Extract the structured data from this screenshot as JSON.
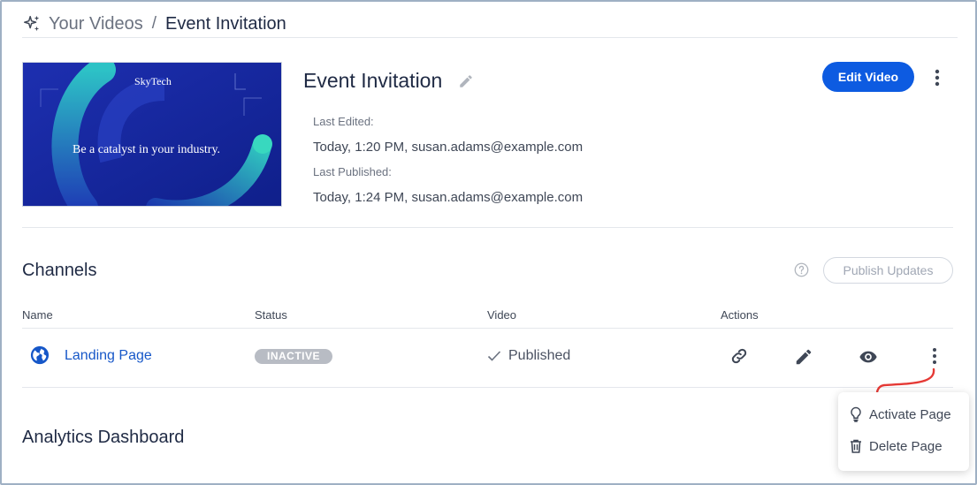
{
  "breadcrumb": {
    "root": "Your Videos",
    "separator": "/",
    "current": "Event Invitation"
  },
  "video": {
    "title": "Event Invitation",
    "thumbnail_brand": "SkyTech",
    "thumbnail_tagline": "Be a catalyst in your industry.",
    "last_edited_label": "Last Edited:",
    "last_edited_value": "Today, 1:20 PM, susan.adams@example.com",
    "last_published_label": "Last Published:",
    "last_published_value": "Today, 1:24 PM, susan.adams@example.com",
    "edit_button": "Edit Video"
  },
  "channels": {
    "title": "Channels",
    "publish_button": "Publish Updates",
    "columns": [
      "Name",
      "Status",
      "Video",
      "Actions"
    ],
    "rows": [
      {
        "name": "Landing Page",
        "status": "INACTIVE",
        "video": "Published",
        "actions": [
          "link-icon",
          "pencil-icon",
          "eye-icon",
          "more-vertical-icon"
        ]
      }
    ]
  },
  "row_menu": {
    "items": [
      {
        "label": "Activate Page",
        "icon": "lightbulb-icon"
      },
      {
        "label": "Delete Page",
        "icon": "trash-icon"
      }
    ]
  },
  "analytics": {
    "title": "Analytics Dashboard"
  },
  "colors": {
    "primary": "#0d5be1",
    "link": "#1657c8",
    "inactive_badge": "#b8bcc4",
    "annotation_arrow": "#e53935"
  }
}
